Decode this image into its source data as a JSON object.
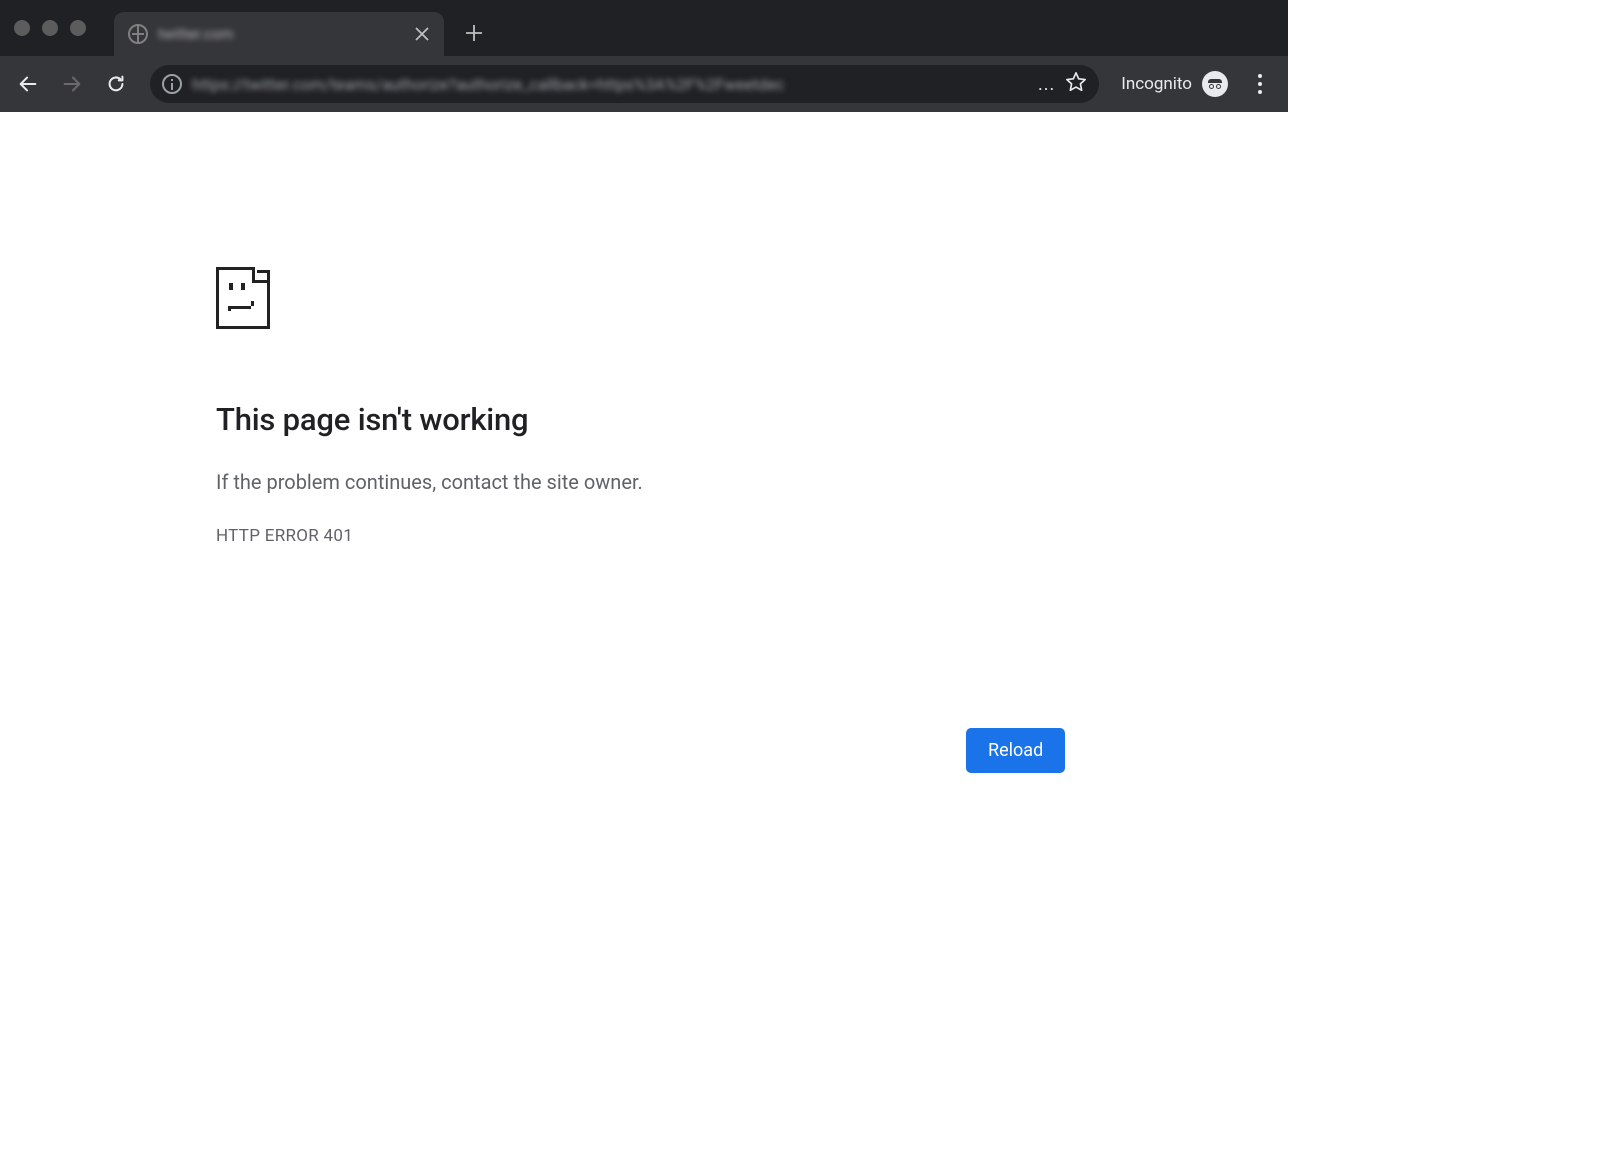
{
  "tab": {
    "title": "twitter.com"
  },
  "toolbar": {
    "url": "https://twitter.com/teams/authorize?authorize_callback=https%3A%2F%2Fweetdec",
    "url_truncation": "...",
    "incognito_label": "Incognito"
  },
  "error": {
    "title": "This page isn't working",
    "message": "If the problem continues, contact the site owner.",
    "code": "HTTP ERROR 401",
    "reload_label": "Reload"
  }
}
